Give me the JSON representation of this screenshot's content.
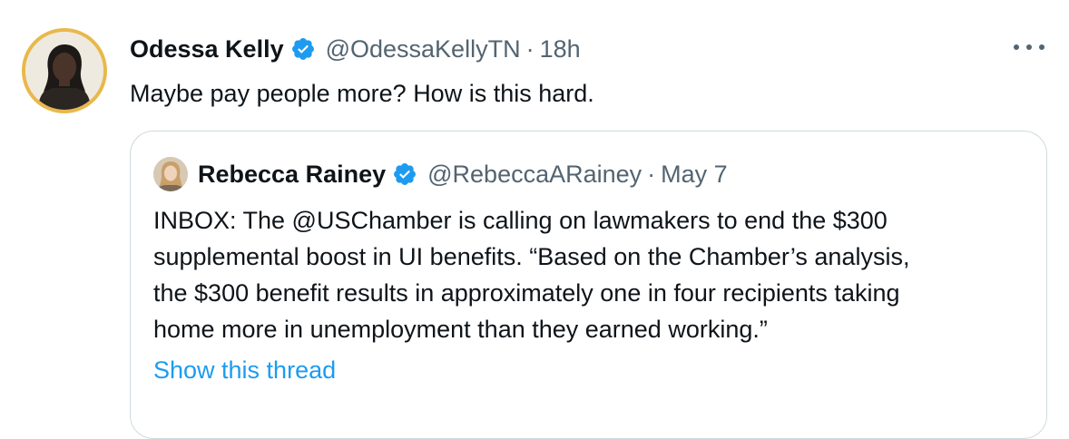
{
  "tweet": {
    "author_name": "Odessa Kelly",
    "author_handle": "@OdessaKellyTN",
    "separator": "·",
    "time": "18h",
    "text": "Maybe pay people more? How is this hard."
  },
  "quoted_tweet": {
    "author_name": "Rebecca Rainey",
    "author_handle": "@RebeccaARainey",
    "separator": "·",
    "time": "May 7",
    "text_lines": [
      "INBOX: The @USChamber is calling on lawmakers to end the $300",
      "supplemental boost in UI benefits. “Based on the Chamber’s analysis,",
      "the $300 benefit results in approximately one in four recipients taking",
      "home more in unemployment than they earned working.”"
    ],
    "show_thread_label": "Show this thread"
  },
  "icons": {
    "verified": "verified-badge-icon",
    "more": "more-options-icon"
  },
  "colors": {
    "text_primary": "#0f1419",
    "text_secondary": "#536471",
    "link": "#1d9bf0",
    "verified": "#1d9bf0",
    "border": "#cfd9de",
    "avatar_ring": "#e8b84a"
  }
}
